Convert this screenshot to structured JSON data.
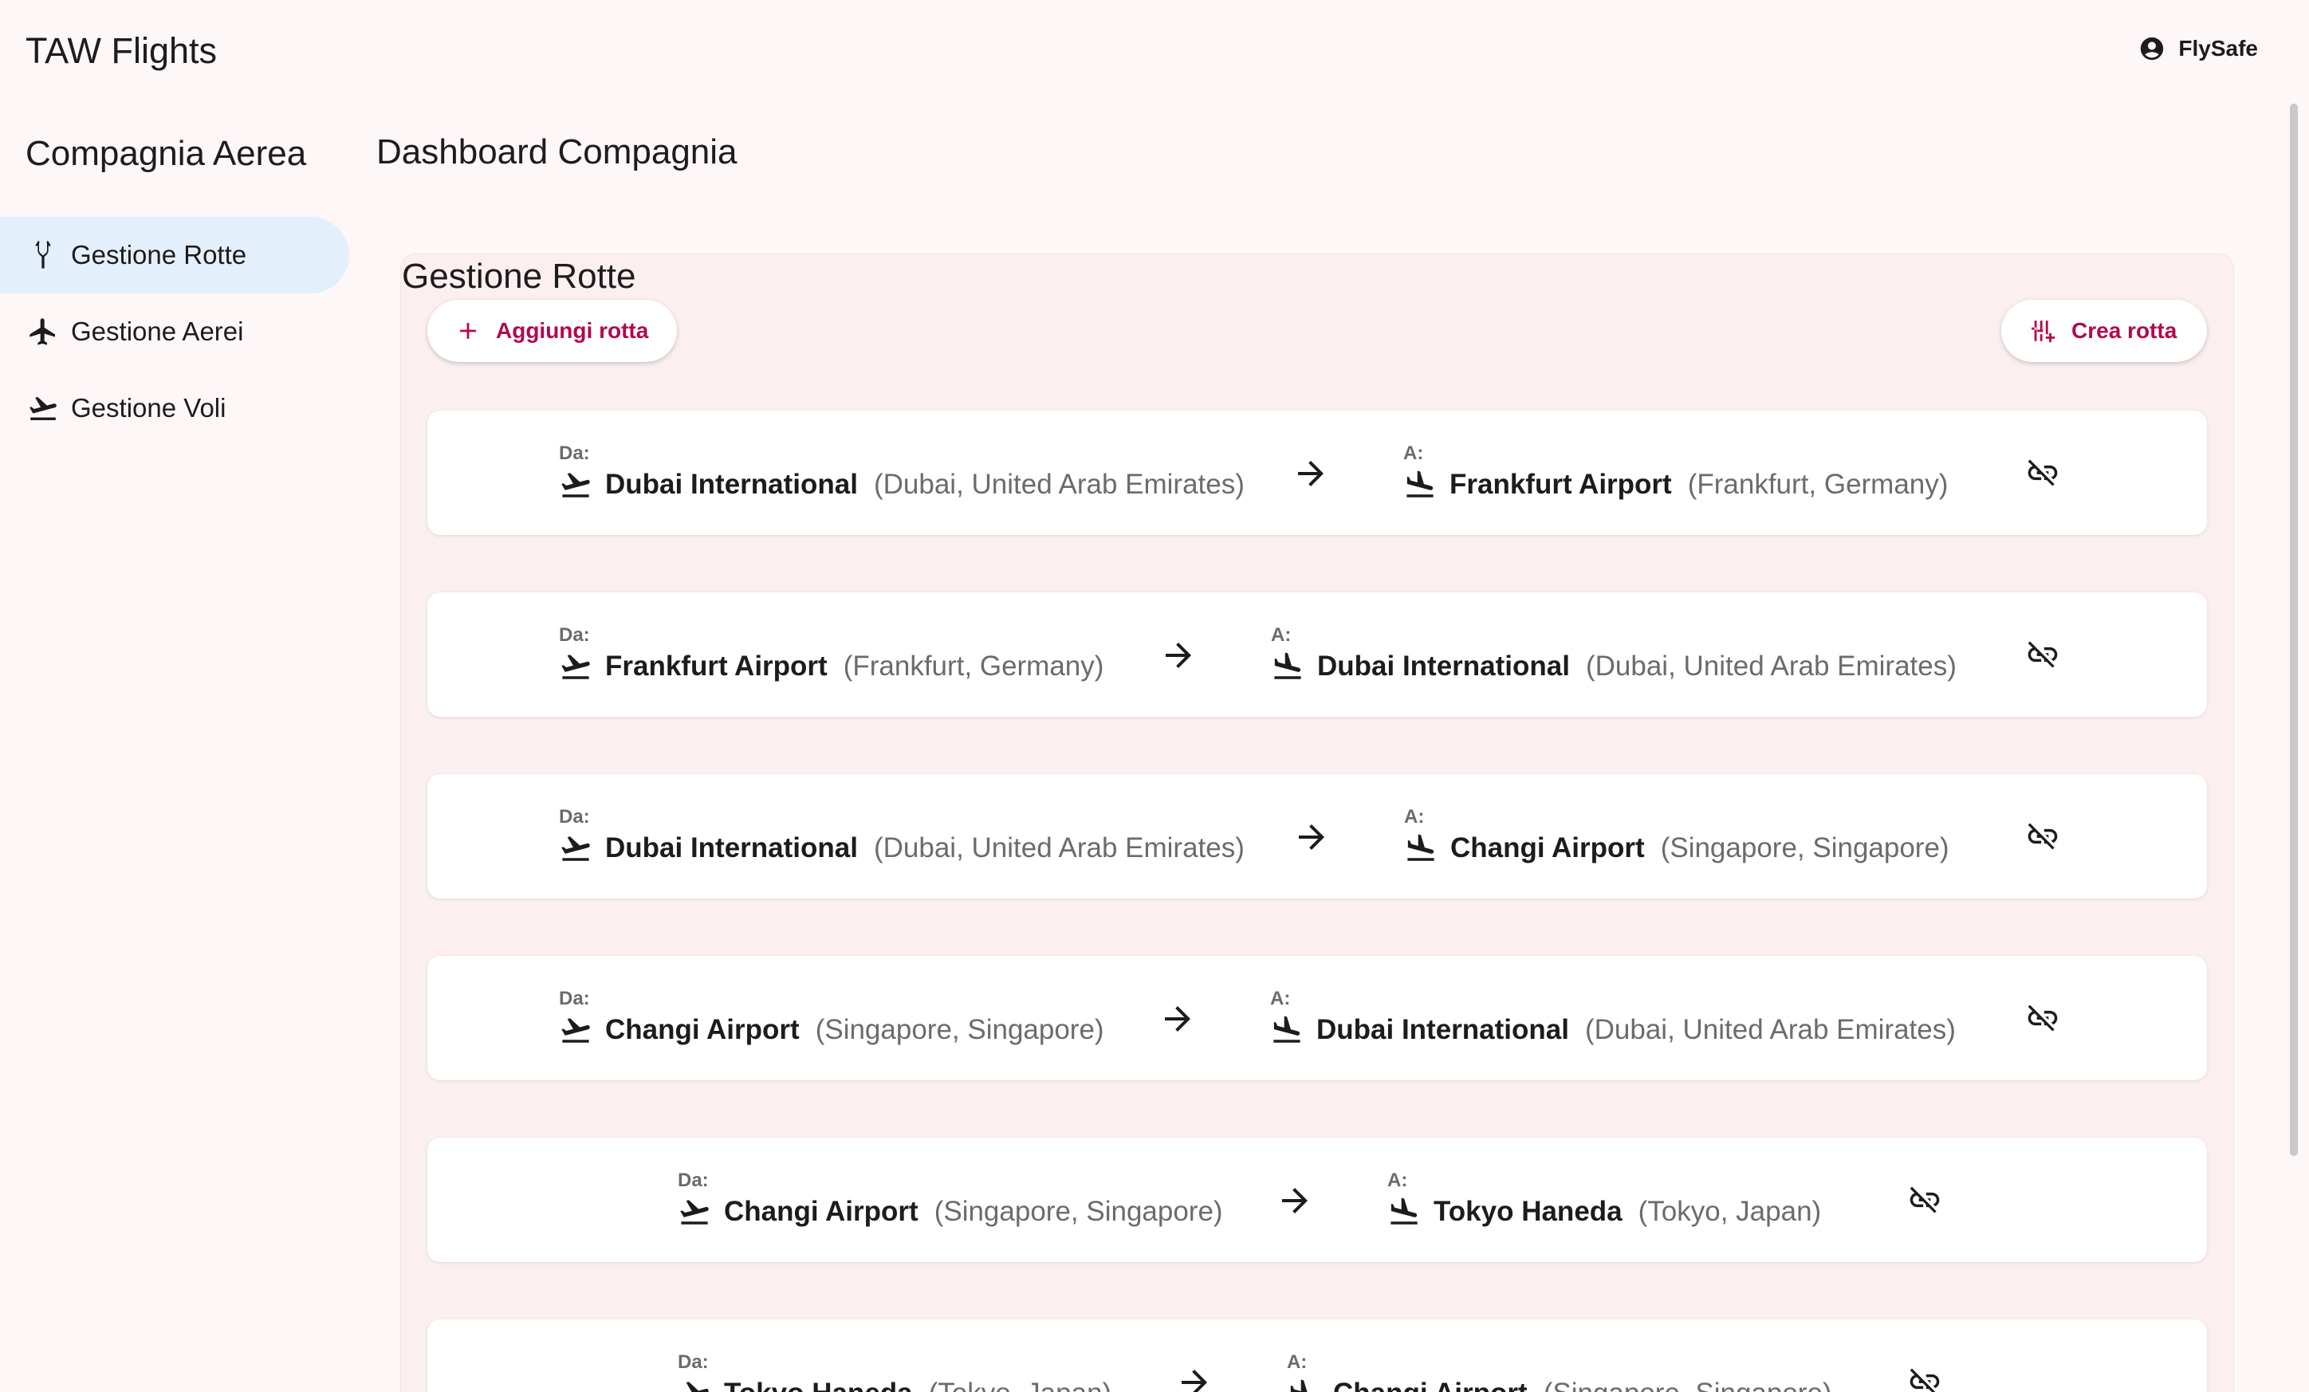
{
  "header": {
    "app_title": "TAW Flights",
    "user_name": "FlySafe"
  },
  "sidebar": {
    "title": "Compagnia Aerea",
    "items": [
      {
        "label": "Gestione Rotte",
        "icon": "fork-route-icon",
        "active": true
      },
      {
        "label": "Gestione Aerei",
        "icon": "airplane-icon",
        "active": false
      },
      {
        "label": "Gestione Voli",
        "icon": "flight-takeoff-icon",
        "active": false
      }
    ]
  },
  "main": {
    "title": "Dashboard Compagnia",
    "panel_title": "Gestione Rotte",
    "add_button": "Aggiungi rotta",
    "create_button": "Crea rotta",
    "from_label": "Da:",
    "to_label": "A:",
    "routes": [
      {
        "from_name": "Dubai International",
        "from_loc": "(Dubai, United Arab Emirates)",
        "to_name": "Frankfurt Airport",
        "to_loc": "(Frankfurt, Germany)"
      },
      {
        "from_name": "Frankfurt Airport",
        "from_loc": "(Frankfurt, Germany)",
        "to_name": "Dubai International",
        "to_loc": "(Dubai, United Arab Emirates)"
      },
      {
        "from_name": "Dubai International",
        "from_loc": "(Dubai, United Arab Emirates)",
        "to_name": "Changi Airport",
        "to_loc": "(Singapore, Singapore)"
      },
      {
        "from_name": "Changi Airport",
        "from_loc": "(Singapore, Singapore)",
        "to_name": "Dubai International",
        "to_loc": "(Dubai, United Arab Emirates)"
      },
      {
        "from_name": "Changi Airport",
        "from_loc": "(Singapore, Singapore)",
        "to_name": "Tokyo Haneda",
        "to_loc": "(Tokyo, Japan)"
      },
      {
        "from_name": "Tokyo Haneda",
        "from_loc": "(Tokyo, Japan)",
        "to_name": "Changi Airport",
        "to_loc": "(Singapore, Singapore)"
      }
    ]
  },
  "colors": {
    "accent": "#b3084e",
    "active_nav": "#e3f0fc",
    "panel_bg": "#fcefef",
    "page_bg": "#fdf7f7"
  }
}
